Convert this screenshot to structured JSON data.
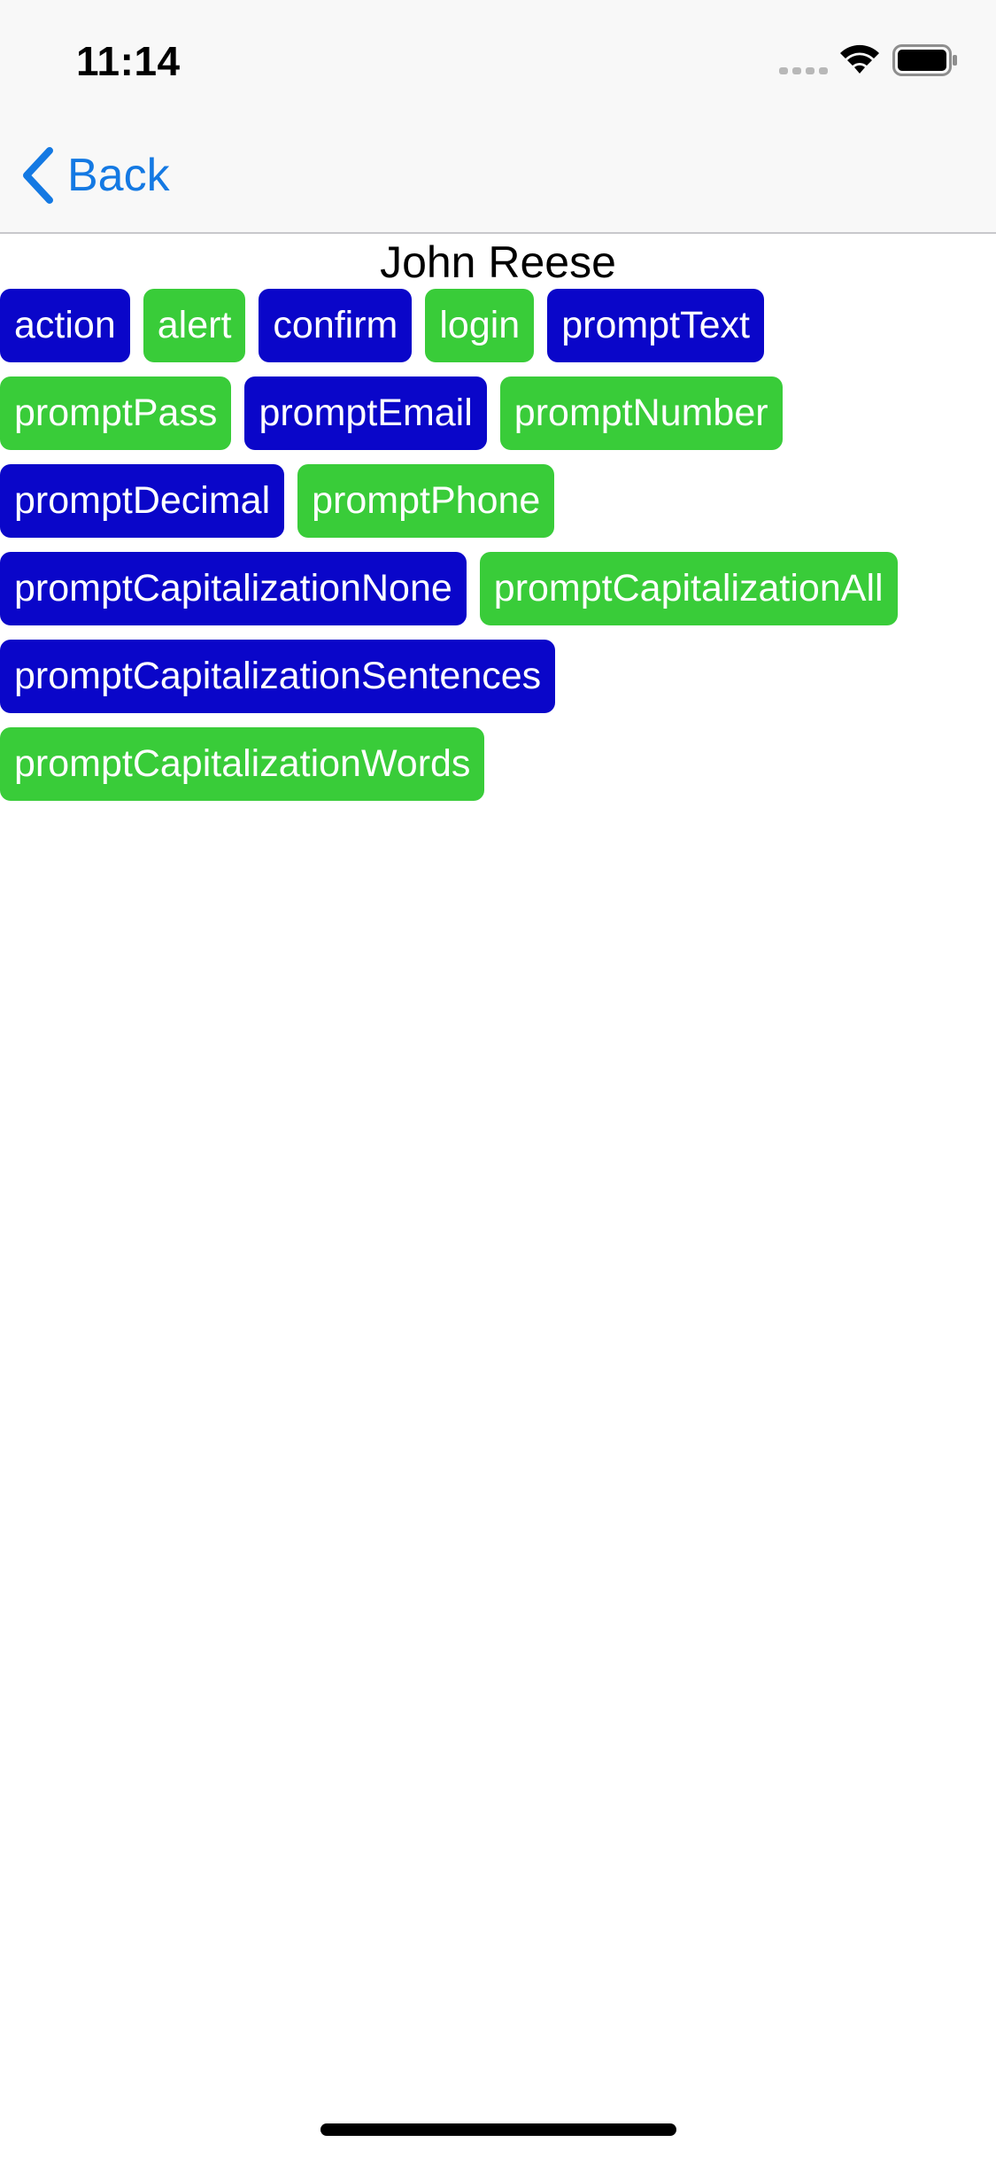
{
  "status_bar": {
    "time": "11:14",
    "icons": [
      "cellular-signal-icon",
      "wifi-icon",
      "battery-icon"
    ]
  },
  "nav": {
    "back_label": "Back",
    "back_icon": "chevron-left-icon"
  },
  "profile": {
    "name": "John Reese"
  },
  "colors": {
    "accent": "#1479e3",
    "blue_button": "#0a06c9",
    "green_button": "#39cc39",
    "bar_background": "#f8f8f8"
  },
  "buttons": [
    {
      "label": "action",
      "color": "#0a06c9"
    },
    {
      "label": "alert",
      "color": "#39cc39"
    },
    {
      "label": "confirm",
      "color": "#0a06c9"
    },
    {
      "label": "login",
      "color": "#39cc39"
    },
    {
      "label": "promptText",
      "color": "#0a06c9"
    },
    {
      "label": "promptPass",
      "color": "#39cc39"
    },
    {
      "label": "promptEmail",
      "color": "#0a06c9"
    },
    {
      "label": "promptNumber",
      "color": "#39cc39"
    },
    {
      "label": "promptDecimal",
      "color": "#0a06c9"
    },
    {
      "label": "promptPhone",
      "color": "#39cc39"
    },
    {
      "label": "promptCapitalizationNone",
      "color": "#0a06c9"
    },
    {
      "label": "promptCapitalizationAll",
      "color": "#39cc39"
    },
    {
      "label": "promptCapitalizationSentences",
      "color": "#0a06c9"
    },
    {
      "label": "promptCapitalizationWords",
      "color": "#39cc39"
    }
  ]
}
